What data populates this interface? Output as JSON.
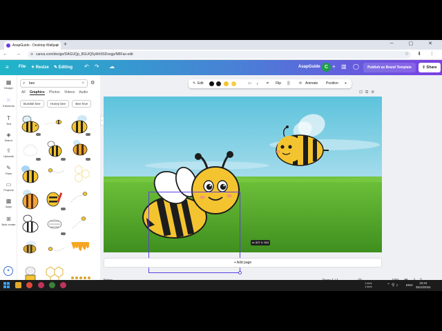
{
  "browser": {
    "tab_title": "AsapGuide - Desktop Wallpap",
    "tab_close": "×",
    "new_tab": "+",
    "url": "canva.com/design/DAGUQp_8GU/Q5yMrtS5Dxegp/NBFas-edit"
  },
  "topbar": {
    "file": "File",
    "resize": "✦ Resize",
    "editing": "✎ Editing",
    "doc_title": "AsapGuide",
    "avatar": "C",
    "publish": "Publish as Brand Template",
    "share": "⇪ Share"
  },
  "rail": {
    "items": [
      {
        "label": "Design",
        "icon": "▦"
      },
      {
        "label": "Elements",
        "icon": "⁙"
      },
      {
        "label": "Text",
        "icon": "T"
      },
      {
        "label": "Brand",
        "icon": "◈"
      },
      {
        "label": "Uploads",
        "icon": "⇪"
      },
      {
        "label": "Draw",
        "icon": "✎"
      },
      {
        "label": "Projects",
        "icon": "▭"
      },
      {
        "label": "Apps",
        "icon": "▩"
      },
      {
        "label": "Bulk create",
        "icon": "⊞"
      }
    ]
  },
  "panel": {
    "search_value": "bee",
    "tabs": [
      "All",
      "Graphics",
      "Photos",
      "Videos",
      "Audio"
    ],
    "active_tab": "Graphics",
    "chips": [
      "Bumble bee",
      "Honey bee",
      "Bee hive"
    ]
  },
  "context_toolbar": {
    "edit": "Edit",
    "flip": "Flip",
    "animate": "Animate",
    "position": "Position",
    "colors": [
      "#111111",
      "#1a1a1a",
      "#f2c230",
      "#f5cf45"
    ]
  },
  "canvas": {
    "size_tag": "w: 827 h: 563",
    "add_page": "+ Add page"
  },
  "footer": {
    "notes": "Notes",
    "page": "Page 1 / 1",
    "zoom": "63%",
    "zoom_level": 0.45
  },
  "taskbar": {
    "tray_text": "1 kb/s\n1 kb/s",
    "lang": "ENG",
    "time": "15:24",
    "date": "25/10/2024"
  }
}
